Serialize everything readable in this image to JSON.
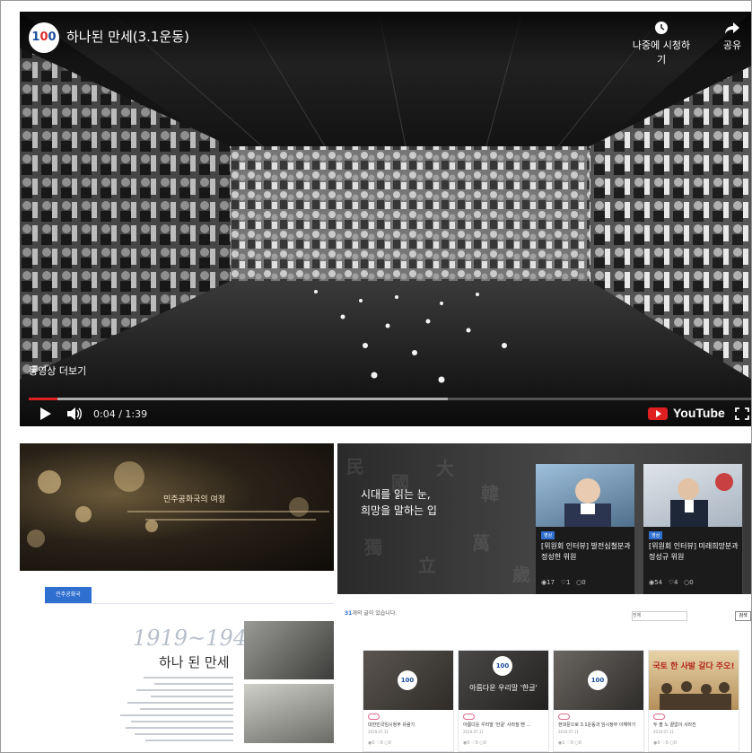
{
  "player": {
    "channel_logo": "100",
    "title": "하나된 만세(3.1운동)",
    "watch_later": "나중에 시청하기",
    "share": "공유",
    "more_videos": "동영상 더보기",
    "time": "0:04 / 1:39",
    "played_fraction": 0.04,
    "buffered_fraction": 0.58,
    "brand": "YouTube",
    "icons": [
      "clock-icon",
      "share-arrow-icon",
      "play-icon",
      "volume-icon",
      "youtube-icon",
      "fullscreen-icon"
    ]
  },
  "left_panel": {
    "hero_title": "민주공화국의 여정",
    "tabs": [
      "민주공화국",
      "",
      "",
      "",
      "",
      ""
    ],
    "year": "1919~1945",
    "subtitle": "하나 된 만세"
  },
  "right_panel": {
    "headline_1": "시대를 읽는 눈,",
    "headline_2": "희망을 말하는 입",
    "interview_cards": [
      {
        "badge": "영상",
        "title": "[위원회 인터뷰] 발전심철분과 정성헌 위원",
        "views": "17",
        "likes": "1",
        "comments": "0"
      },
      {
        "badge": "영상",
        "title": "[위원회 인터뷰] 미래희망분과 정성규 위원",
        "views": "54",
        "likes": "4",
        "comments": "0"
      }
    ],
    "post_count_num": "31",
    "post_count_text": "개의 글이 있습니다.",
    "search_select": "전체",
    "search_button": "검색",
    "posts": [
      {
        "tag": "",
        "title": "대한민국임시정부 유람기",
        "date": "2019.07.11",
        "views": "0",
        "likes": "0",
        "comments": "0",
        "thumb_text": ""
      },
      {
        "tag": "",
        "title": "아름다운 우리말 '한글' 사라질 뻔 …",
        "date": "2019.07.11",
        "views": "0",
        "likes": "0",
        "comments": "0",
        "thumb_text": "아름다운 우리말 '한글'"
      },
      {
        "tag": "",
        "title": "현대문으로 3.1운동과 임시정부 이해하기",
        "date": "2019.07.11",
        "views": "1",
        "likes": "0",
        "comments": "0",
        "thumb_text": ""
      },
      {
        "tag": "",
        "title": "두 팔 노 끝없이 사라진",
        "date": "2019.07.11",
        "views": "0",
        "likes": "0",
        "comments": "0",
        "thumb_text": "국토 한 사발 갈다 주오!"
      }
    ]
  },
  "colors": {
    "accent": "#2e6fd0",
    "progress": "#e02020",
    "tag": "#e06a8a"
  }
}
